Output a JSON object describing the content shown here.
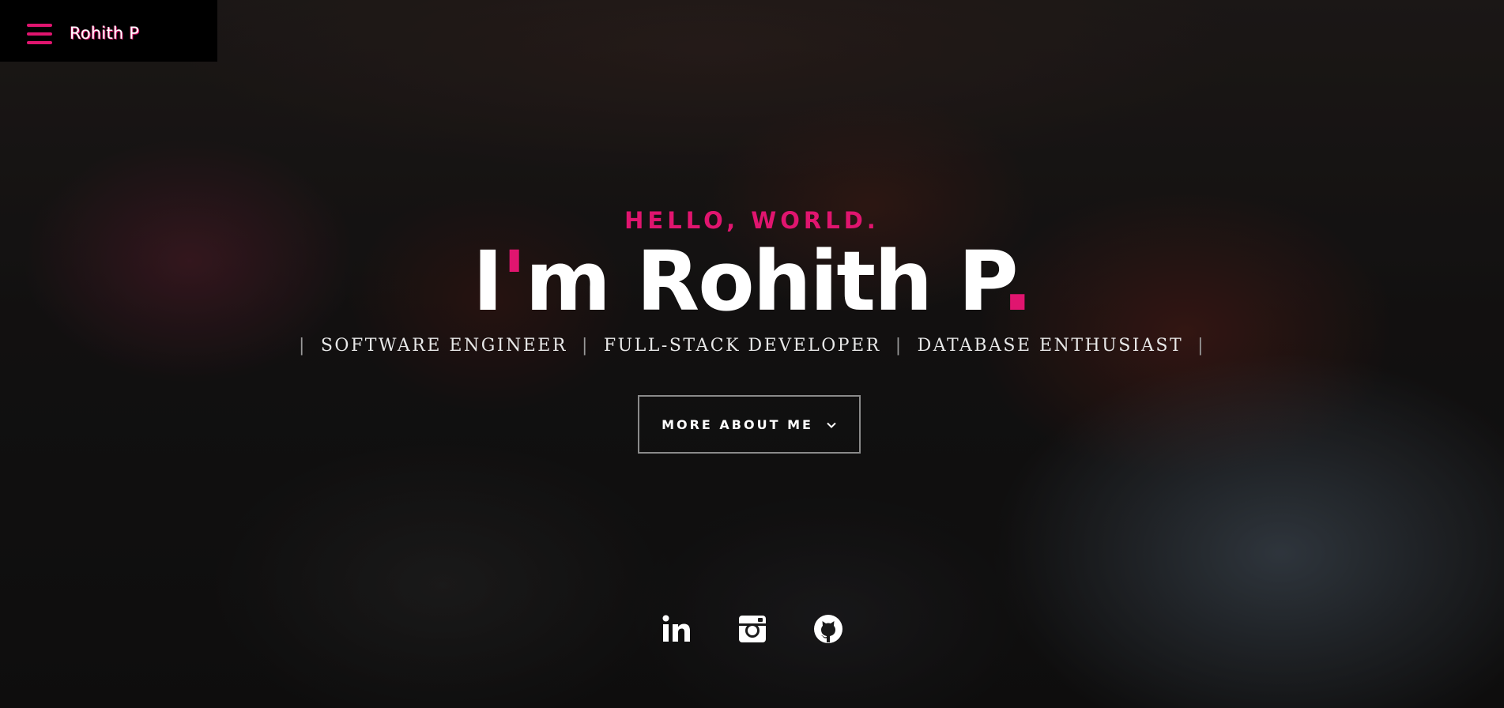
{
  "nav": {
    "brand": "Rohith P",
    "menu_icon": "hamburger-menu-icon"
  },
  "hero": {
    "greeting": "HELLO, WORLD.",
    "name_prefix": "I",
    "name_apostrophe": "'",
    "name_main": "m Rohith P",
    "name_dot": ".",
    "roles": [
      "SOFTWARE ENGINEER",
      "FULL-STACK DEVELOPER",
      "DATABASE ENTHUSIAST"
    ],
    "separator": "|",
    "cta_label": "MORE ABOUT ME",
    "cta_icon": "chevron-down-icon"
  },
  "social": [
    {
      "name": "linkedin",
      "icon": "linkedin-icon"
    },
    {
      "name": "instagram",
      "icon": "instagram-icon"
    },
    {
      "name": "github",
      "icon": "github-icon"
    }
  ],
  "colors": {
    "accent": "#e0156f",
    "text": "#ffffff",
    "nav_bg": "#000000"
  }
}
